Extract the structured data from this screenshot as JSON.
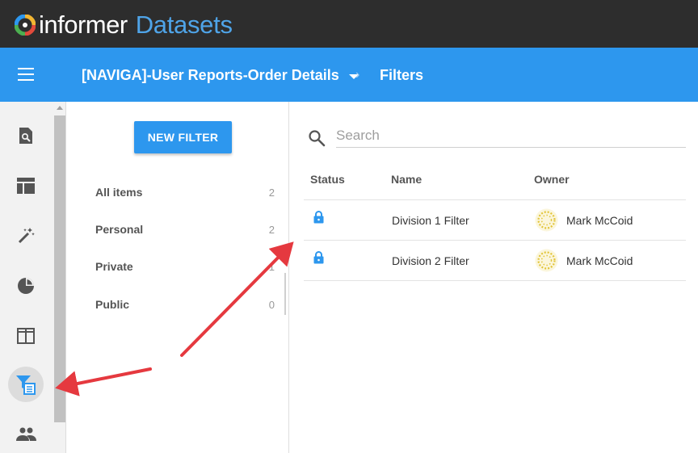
{
  "app": {
    "brand": "informer",
    "product": "Datasets"
  },
  "breadcrumb": {
    "dataset": "[NAVIGA]-User Reports-Order Details",
    "separator": "›",
    "current": "Filters"
  },
  "sidebar": {
    "icons": [
      "dataset-search-icon",
      "dashboard-layout-icon",
      "magic-wand-icon",
      "pie-chart-icon",
      "columns-view-icon",
      "filter-icon",
      "people-icon"
    ],
    "active": "filter-icon"
  },
  "filters_panel": {
    "new_filter_label": "NEW FILTER",
    "categories": [
      {
        "label": "All items",
        "count": "2"
      },
      {
        "label": "Personal",
        "count": "2"
      },
      {
        "label": "Private",
        "count": "1"
      },
      {
        "label": "Public",
        "count": "0"
      }
    ]
  },
  "search": {
    "placeholder": "Search",
    "value": ""
  },
  "table": {
    "headers": {
      "status": "Status",
      "name": "Name",
      "owner": "Owner"
    },
    "rows": [
      {
        "status": "lock-icon",
        "name": "Division 1 Filter",
        "owner": "Mark McCoid"
      },
      {
        "status": "lock-icon",
        "name": "Division 2 Filter",
        "owner": "Mark McCoid"
      }
    ]
  },
  "colors": {
    "topbar": "#2d2d2d",
    "header": "#2d97ee",
    "accent": "#2d97ee",
    "annotation_arrow": "#e5393f"
  }
}
